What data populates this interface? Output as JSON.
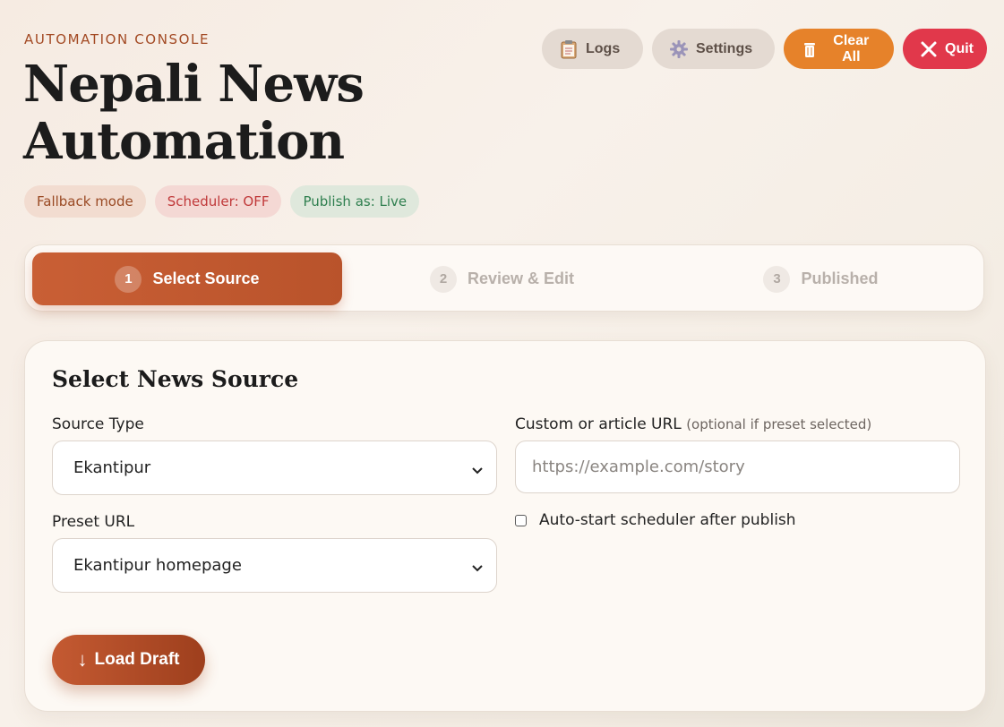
{
  "header": {
    "eyebrow": "AUTOMATION CONSOLE",
    "title_line1": "Nepali News",
    "title_line2": "Automation"
  },
  "badges": {
    "fallback": "Fallback mode",
    "scheduler": "Scheduler: OFF",
    "publish": "Publish as: Live"
  },
  "actions": {
    "logs": "Logs",
    "settings": "Settings",
    "clear": "Clear All",
    "quit": "Quit"
  },
  "steps": [
    {
      "num": "1",
      "label": "Select Source"
    },
    {
      "num": "2",
      "label": "Review & Edit"
    },
    {
      "num": "3",
      "label": "Published"
    }
  ],
  "form": {
    "title": "Select News Source",
    "source_type_label": "Source Type",
    "source_type_value": "Ekantipur",
    "preset_url_label": "Preset URL",
    "preset_url_value": "Ekantipur homepage",
    "custom_url_label": "Custom or article URL",
    "custom_url_hint": "(optional if preset selected)",
    "custom_url_placeholder": "https://example.com/story",
    "auto_start_label": "Auto-start scheduler after publish",
    "load_button": "Load Draft",
    "load_arrow": "↓"
  },
  "colors": {
    "accent": "#c95f35",
    "clear": "#e6822a",
    "quit": "#e1384b"
  }
}
